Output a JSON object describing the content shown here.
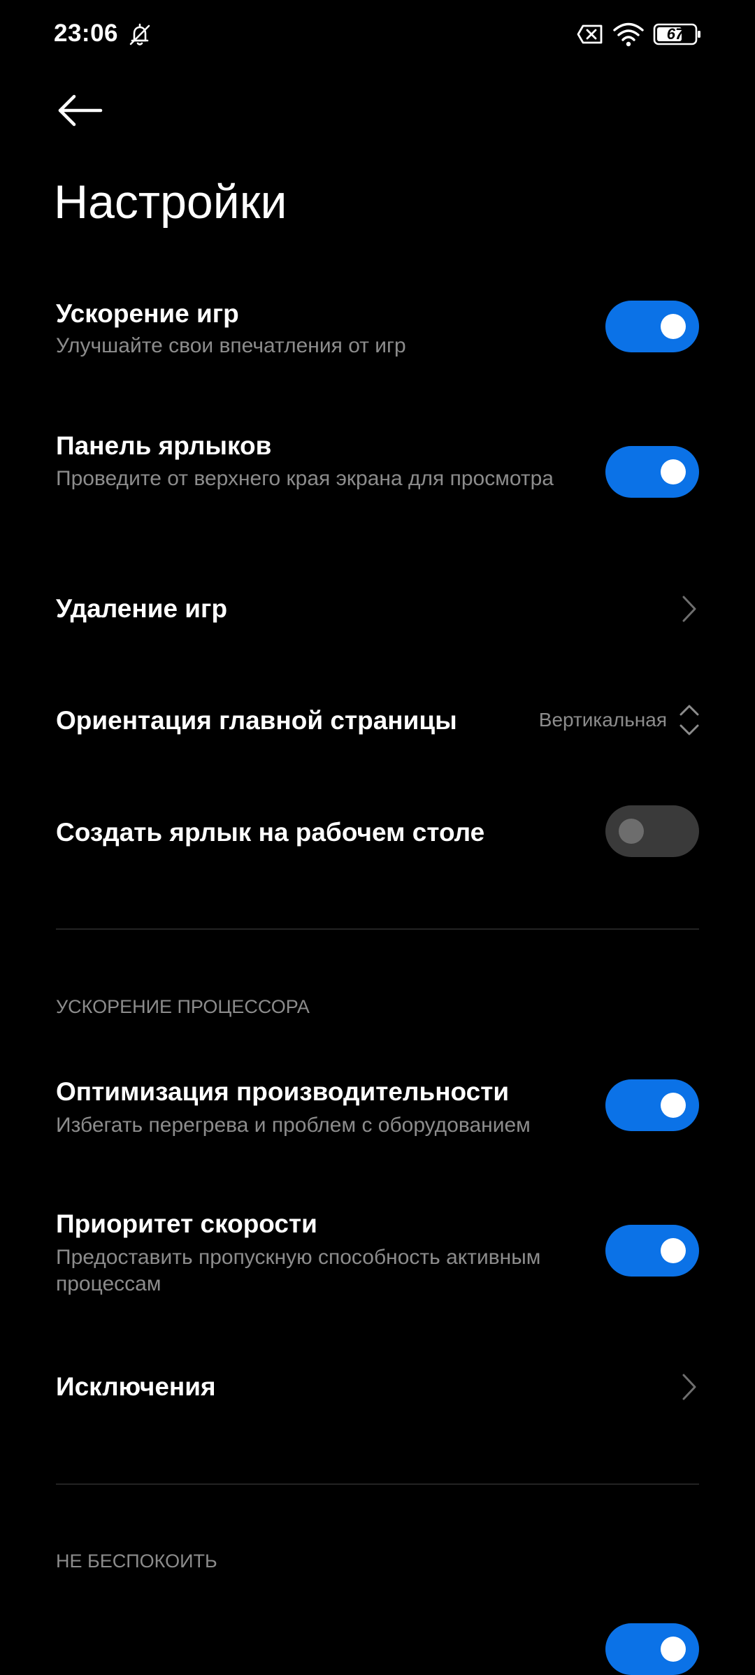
{
  "status_bar": {
    "time": "23:06",
    "icons": [
      "bell-off-icon",
      "sim-x-icon",
      "wifi-icon",
      "battery-icon"
    ],
    "battery_level": "67"
  },
  "header": {
    "back_icon": "arrow-left-icon",
    "title": "Настройки"
  },
  "settings": {
    "game_boost": {
      "title": "Ускорение игр",
      "subtitle": "Улучшайте свои впечатления от игр",
      "enabled": true
    },
    "shortcut_panel": {
      "title": "Панель ярлыков",
      "subtitle": "Проведите от верхнего края экрана для просмотра",
      "enabled": true
    },
    "remove_games": {
      "title": "Удаление игр"
    },
    "home_orientation": {
      "title": "Ориентация главной страницы",
      "value": "Вертикальная"
    },
    "desktop_shortcut": {
      "title": "Создать ярлык на рабочем столе",
      "enabled": false
    }
  },
  "cpu_section": {
    "header": "УСКОРЕНИЕ ПРОЦЕССОРА",
    "performance": {
      "title": "Оптимизация производительности",
      "subtitle": "Избегать перегрева и проблем с оборудованием",
      "enabled": true
    },
    "speed_priority": {
      "title": "Приоритет скорости",
      "subtitle": "Предоставить пропускную способность активным процессам",
      "enabled": true
    },
    "exceptions": {
      "title": "Исключения"
    }
  },
  "dnd_section": {
    "header": "НЕ БЕСПОКОИТЬ"
  },
  "colors": {
    "background": "#000000",
    "accent": "#0b72e7",
    "secondary_text": "#8c8c8c",
    "toggle_off": "#3a3a3a"
  }
}
